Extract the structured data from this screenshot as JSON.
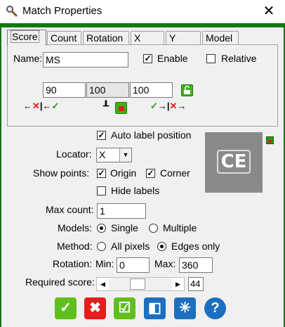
{
  "window": {
    "title": "Match Properties",
    "close_glyph": "✕"
  },
  "tabs": [
    {
      "label": "Score",
      "active": true
    },
    {
      "label": "Count"
    },
    {
      "label": "Rotation"
    },
    {
      "label": "X"
    },
    {
      "label": "Y"
    },
    {
      "label": "Model"
    }
  ],
  "score": {
    "name_label": "Name:",
    "name_value": "MS",
    "enable_label": "Enable",
    "enable_checked": true,
    "relative_label": "Relative",
    "relative_checked": false,
    "low_value": "90",
    "mid_value": "100",
    "high_value": "100",
    "low_icons": "←✕|←✓",
    "high_icons": "✓→|✕→"
  },
  "options": {
    "auto_label": "Auto label position",
    "auto_checked": true,
    "locator_label": "Locator:",
    "locator_value": "X",
    "show_points_label": "Show points:",
    "origin_label": "Origin",
    "origin_checked": true,
    "corner_label": "Corner",
    "corner_checked": true,
    "hide_labels_label": "Hide labels",
    "hide_labels_checked": false,
    "preview_symbol": "CE",
    "max_count_label": "Max count:",
    "max_count_value": "1",
    "models_label": "Models:",
    "single_label": "Single",
    "multiple_label": "Multiple",
    "models_selected": "Single",
    "method_label": "Method:",
    "all_pixels_label": "All pixels",
    "edges_only_label": "Edges only",
    "method_selected": "Edges only",
    "rotation_label": "Rotation:",
    "min_label": "Min:",
    "min_value": "0",
    "max_label": "Max:",
    "max_value": "360",
    "required_score_label": "Required score:",
    "required_score_value": "44",
    "required_score_fraction": 0.44
  },
  "colors": {
    "green": "#3cb317",
    "red": "#e31c1c",
    "blue": "#1c6fbf",
    "preview_bg": "#8a8a8a"
  },
  "buttons": [
    {
      "name": "ok-button",
      "icon": "checkmark-icon",
      "glyph": "✓",
      "color": "#5fbf1c"
    },
    {
      "name": "cancel-button",
      "icon": "x-icon",
      "glyph": "✖",
      "color": "#e31c1c"
    },
    {
      "name": "apply-button",
      "icon": "check-box-icon",
      "glyph": "☑",
      "color": "#5fbf1c"
    },
    {
      "name": "toggle-view-button",
      "icon": "half-square-icon",
      "glyph": "◧",
      "color": "#1c6fbf"
    },
    {
      "name": "light-button",
      "icon": "sparkle-icon",
      "glyph": "✳",
      "color": "#1c6fbf"
    },
    {
      "name": "help-button",
      "icon": "question-icon",
      "glyph": "?",
      "color": "#1c6fbf"
    }
  ]
}
